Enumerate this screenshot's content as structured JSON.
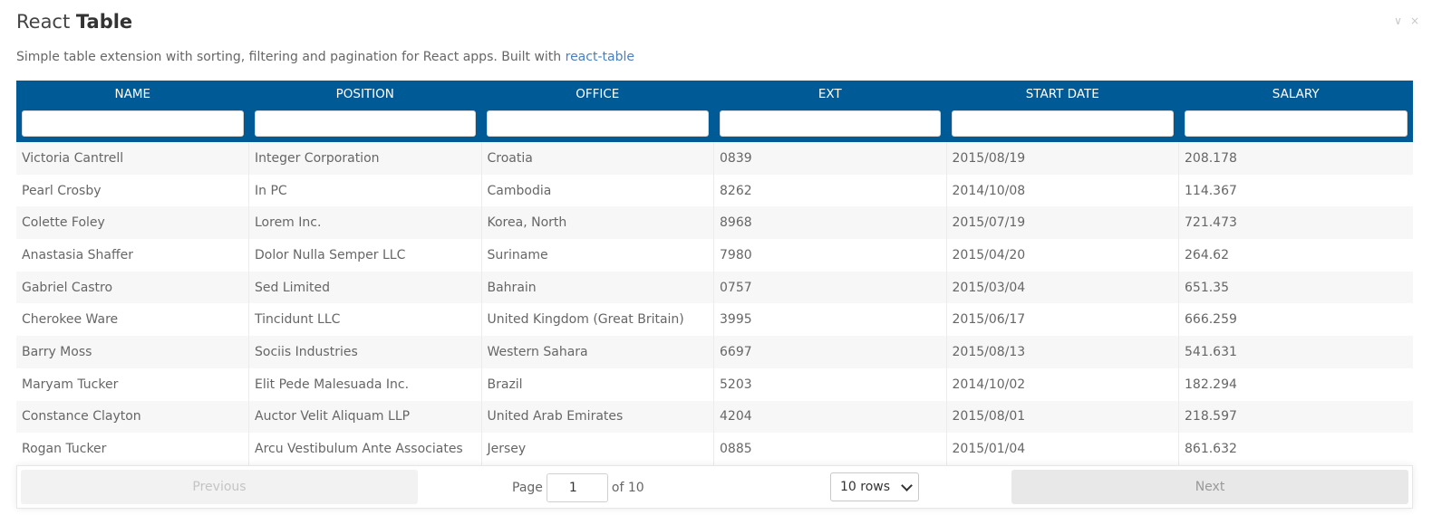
{
  "header": {
    "title_light": "React",
    "title_bold": "Table",
    "minimize_icon": "∨",
    "close_icon": "×"
  },
  "subtitle": {
    "text": "Simple table extension with sorting, filtering and pagination for React apps. Built with",
    "link_text": "react-table"
  },
  "table": {
    "columns": [
      "NAME",
      "POSITION",
      "OFFICE",
      "EXT",
      "START DATE",
      "SALARY"
    ],
    "filters": [
      "",
      "",
      "",
      "",
      "",
      ""
    ],
    "rows": [
      [
        "Victoria Cantrell",
        "Integer Corporation",
        "Croatia",
        "0839",
        "2015/08/19",
        "208.178"
      ],
      [
        "Pearl Crosby",
        "In PC",
        "Cambodia",
        "8262",
        "2014/10/08",
        "114.367"
      ],
      [
        "Colette Foley",
        "Lorem Inc.",
        "Korea, North",
        "8968",
        "2015/07/19",
        "721.473"
      ],
      [
        "Anastasia Shaffer",
        "Dolor Nulla Semper LLC",
        "Suriname",
        "7980",
        "2015/04/20",
        "264.62"
      ],
      [
        "Gabriel Castro",
        "Sed Limited",
        "Bahrain",
        "0757",
        "2015/03/04",
        "651.35"
      ],
      [
        "Cherokee Ware",
        "Tincidunt LLC",
        "United Kingdom (Great Britain)",
        "3995",
        "2015/06/17",
        "666.259"
      ],
      [
        "Barry Moss",
        "Sociis Industries",
        "Western Sahara",
        "6697",
        "2015/08/13",
        "541.631"
      ],
      [
        "Maryam Tucker",
        "Elit Pede Malesuada Inc.",
        "Brazil",
        "5203",
        "2014/10/02",
        "182.294"
      ],
      [
        "Constance Clayton",
        "Auctor Velit Aliquam LLP",
        "United Arab Emirates",
        "4204",
        "2015/08/01",
        "218.597"
      ],
      [
        "Rogan Tucker",
        "Arcu Vestibulum Ante Associates",
        "Jersey",
        "0885",
        "2015/01/04",
        "861.632"
      ]
    ],
    "header_color": "#005a96"
  },
  "pagination": {
    "previous_label": "Previous",
    "next_label": "Next",
    "page_label": "Page",
    "current_page": "1",
    "of_label": "of 10",
    "rows_option": "10 rows"
  }
}
